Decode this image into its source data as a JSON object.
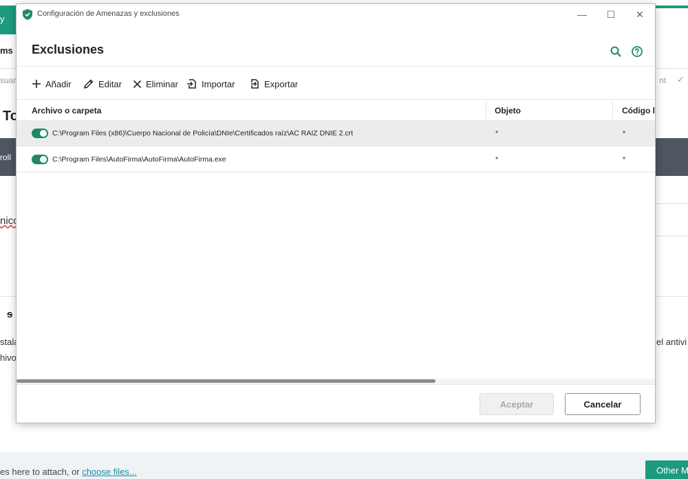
{
  "background": {
    "fragment_top_y": "y",
    "fragment_ms": "ms",
    "fragment_usuar": "suar",
    "fragment_nt": "nt",
    "fragment_to": "To",
    "fragment_roll": "roll",
    "fragment_nico": "nico",
    "fragment_s": "s",
    "fragment_stala": "stala",
    "fragment_hivo": "hivo",
    "fragment_antivi": "el antivi",
    "attach_text": "es here to attach, or ",
    "attach_link": "choose files...",
    "other_button": "Other Mo",
    "accent_color": "#1e9a7e",
    "dark_band_color": "#4f5661"
  },
  "dialog": {
    "window_title": "Configuración de Amenazas y exclusiones",
    "app_icon": "shield-check-icon",
    "window_controls": {
      "minimize": "—",
      "maximize": "☐",
      "close": "✕"
    },
    "page_title": "Exclusiones",
    "header_icons": [
      "search-icon",
      "help-icon"
    ],
    "toolbar": {
      "add": "Añadir",
      "edit": "Editar",
      "delete": "Eliminar",
      "import": "Importar",
      "export": "Exportar"
    },
    "table": {
      "columns": [
        "Archivo o carpeta",
        "Objeto",
        "Código l"
      ],
      "rows": [
        {
          "enabled": true,
          "path": "C:\\Program Files (x86)\\Cuerpo Nacional de Policía\\DNIe\\Certificados raíz\\AC RAIZ DNIE 2.crt",
          "object": "*",
          "code": "*",
          "selected": true
        },
        {
          "enabled": true,
          "path": "C:\\Program Files\\AutoFirma\\AutoFirma\\AutoFirma.exe",
          "object": "*",
          "code": "*",
          "selected": false
        }
      ]
    },
    "footer": {
      "accept": "Aceptar",
      "cancel": "Cancelar"
    },
    "toggle_color": "#1e8a67"
  }
}
